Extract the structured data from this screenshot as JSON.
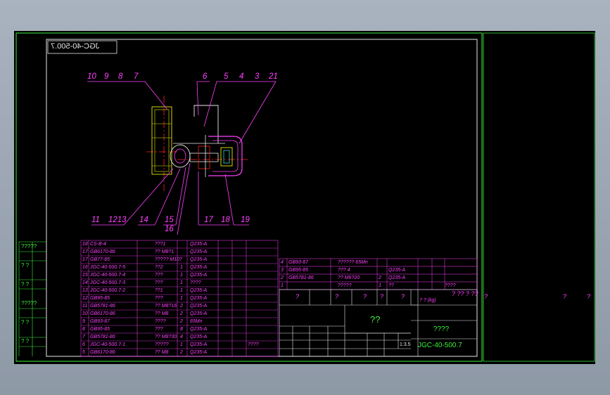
{
  "drawing_no": "JGC-40-500.7",
  "drawing_no_mirrored": "JGC-40-500.7",
  "colors": {
    "frame": "#3cf03c",
    "border": "#e8e8e8",
    "leader": "#ff40ff",
    "table_line": "#ff40ff",
    "part": "#e8e800",
    "center": "#ff2020",
    "hidden": "#3cf0f0"
  },
  "balloons_top": [
    "10",
    "9",
    "8",
    "7",
    "6",
    "5",
    "4",
    "3",
    "21"
  ],
  "balloons_bottom": [
    "11",
    "1213",
    "14",
    "15",
    "17",
    "18",
    "19"
  ],
  "balloon_16": "16",
  "left_strip": [
    "?????",
    "?  ?",
    "?  ?",
    "?????",
    "?  ?",
    "?  ?"
  ],
  "bom_rows": [
    {
      "no": "18",
      "code": "CS-B-4",
      "name": "???1",
      "qty": "",
      "mat": "Q235-A"
    },
    {
      "no": "17",
      "code": "GB6170-86",
      "name": "?? M8?1",
      "qty": "",
      "mat": "Q235-A"
    },
    {
      "no": "17",
      "code": "GB77-85",
      "name": "????? M10?",
      "qty": "",
      "mat": "Q235-A"
    },
    {
      "no": "16",
      "code": "JGC-40-500.7-5",
      "name": "??2",
      "qty": "1",
      "mat": "Q235-A"
    },
    {
      "no": "15",
      "code": "JGC-40-500.7-4",
      "name": "???",
      "qty": "1",
      "mat": "Q235-A"
    },
    {
      "no": "14",
      "code": "JGC-40-500.7-3",
      "name": "???",
      "qty": "1",
      "mat": "????"
    },
    {
      "no": "13",
      "code": "JGC-40-500.7-2",
      "name": "??1",
      "qty": "1",
      "mat": "Q235-A"
    },
    {
      "no": "12",
      "code": "GB95-85",
      "name": "???",
      "qty": "1",
      "mat": "Q235-A"
    },
    {
      "no": "11",
      "code": "GB5781-86",
      "name": "?? M8?16",
      "qty": "2",
      "mat": "Q235-A"
    },
    {
      "no": "10",
      "code": "GB6170-86",
      "name": "?? M8",
      "qty": "2",
      "mat": "Q235-A"
    },
    {
      "no": "9",
      "code": "GB93-87",
      "name": "????",
      "qty": "2",
      "mat": "65Mn"
    },
    {
      "no": "8",
      "code": "GB95-85",
      "name": "???",
      "qty": "8",
      "mat": "Q235-A"
    },
    {
      "no": "7",
      "code": "GB5781-86",
      "name": "?? M8?30",
      "qty": "4",
      "mat": "Q235-A"
    },
    {
      "no": "6",
      "code": "JGC-40-500.7-1",
      "name": "?????",
      "qty": "1",
      "mat": "Q235-A",
      "note": "????"
    },
    {
      "no": "5",
      "code": "GB6170-86",
      "name": "?? M8",
      "qty": "2",
      "mat": "Q235-A"
    }
  ],
  "upper_rows": [
    {
      "no": "4",
      "code": "GB93-87",
      "name": "?????? 65Mn",
      "qty": "",
      "mat": ""
    },
    {
      "no": "3",
      "code": "GB95-85",
      "name": "??? 4",
      "qty": "",
      "mat": "Q235-A"
    },
    {
      "no": "2",
      "code": "GB5781-86",
      "name": "?? M6?20",
      "qty": "2",
      "mat": "Q235-A"
    },
    {
      "no": "1",
      "code": "",
      "name": "?????",
      "qty": "1",
      "mat": "??"
    }
  ],
  "upper_extra": "????",
  "header_marks": "?   ??    ?   ??",
  "title_block": {
    "a": "?",
    "b": "?",
    "c": "?",
    "d": "?",
    "e": "?",
    "f": "?",
    "g": "?",
    "weight": "? ? (kg)",
    "main_title": "??",
    "subtitle": "????",
    "scale": "1:3.5",
    "code": "JGC-40-500.7",
    "right_marks": [
      "?",
      "?",
      "?"
    ]
  }
}
